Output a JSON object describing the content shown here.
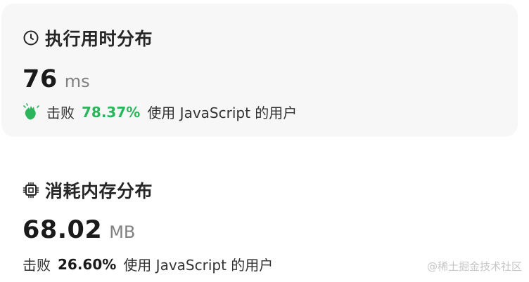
{
  "runtime": {
    "title": "执行用时分布",
    "value": "76",
    "unit": "ms",
    "beats_label": "击败",
    "beats_percent": "78.37%",
    "beats_suffix": "使用 JavaScript 的用户",
    "icon": "clock-icon",
    "hands_icon": "clapping-hands-icon",
    "accent_color": "#2db55d"
  },
  "memory": {
    "title": "消耗内存分布",
    "value": "68.02",
    "unit": "MB",
    "beats_label": "击败",
    "beats_percent": "26.60%",
    "beats_suffix": "使用 JavaScript 的用户",
    "icon": "chip-icon"
  },
  "watermark": "@稀土掘金技术社区"
}
